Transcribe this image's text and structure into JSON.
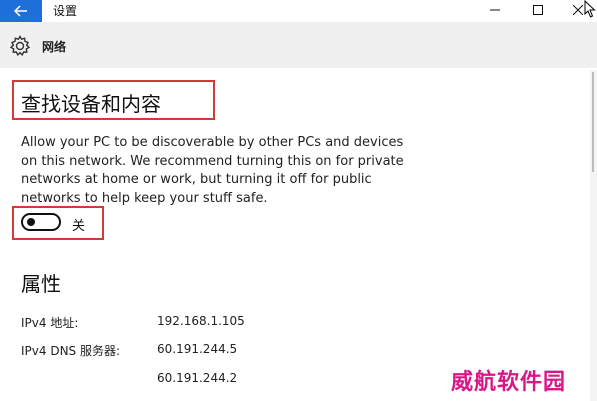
{
  "window": {
    "title": "设置"
  },
  "header": {
    "title": "网络",
    "icon": "gear-icon"
  },
  "discovery": {
    "heading": "查找设备和内容",
    "description": "Allow your PC to be discoverable by other PCs and devices on this network. We recommend turning this on for private networks at home or work, but turning it off for public networks to help keep your stuff safe.",
    "toggle_state": "关",
    "toggle_on": false
  },
  "properties": {
    "heading": "属性",
    "rows": [
      {
        "label": "IPv4 地址:",
        "value": "192.168.1.105"
      },
      {
        "label": "IPv4 DNS 服务器:",
        "value": "60.191.244.5"
      },
      {
        "label": "",
        "value": "60.191.244.2"
      }
    ]
  },
  "watermark": "威航软件园",
  "colors": {
    "accent": "#1e6fd9",
    "highlight_border": "#d23a3a",
    "watermark": "#d8188a"
  }
}
